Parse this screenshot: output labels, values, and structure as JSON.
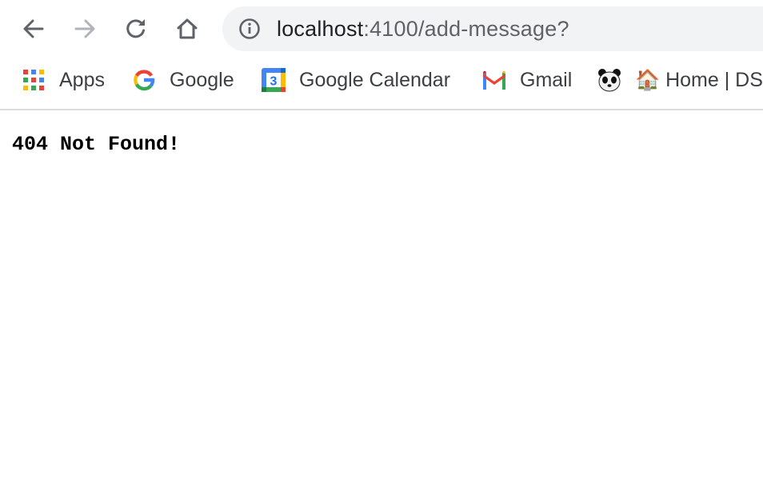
{
  "toolbar": {
    "back_icon": "arrow-left",
    "forward_icon": "arrow-right",
    "reload_icon": "reload",
    "home_icon": "home"
  },
  "omnibox": {
    "info_icon": "info-circle",
    "url_host": "localhost",
    "url_path": ":4100/add-message?"
  },
  "bookmarks": {
    "items": [
      {
        "label": "Apps",
        "icon": "apps-grid-icon"
      },
      {
        "label": "Google",
        "icon": "google-g-icon"
      },
      {
        "label": "Google Calendar",
        "icon": "google-calendar-icon",
        "icon_text": "3"
      },
      {
        "label": "Gmail",
        "icon": "gmail-icon"
      },
      {
        "label": "",
        "icon": "panda-icon"
      },
      {
        "label": "🏠 Home | DS",
        "icon": ""
      }
    ]
  },
  "page": {
    "message": "404 Not Found!"
  },
  "colors": {
    "omnibox_bg": "#f1f3f4",
    "text_primary": "#202124",
    "text_secondary": "#5f6368",
    "divider": "#dadce0"
  }
}
